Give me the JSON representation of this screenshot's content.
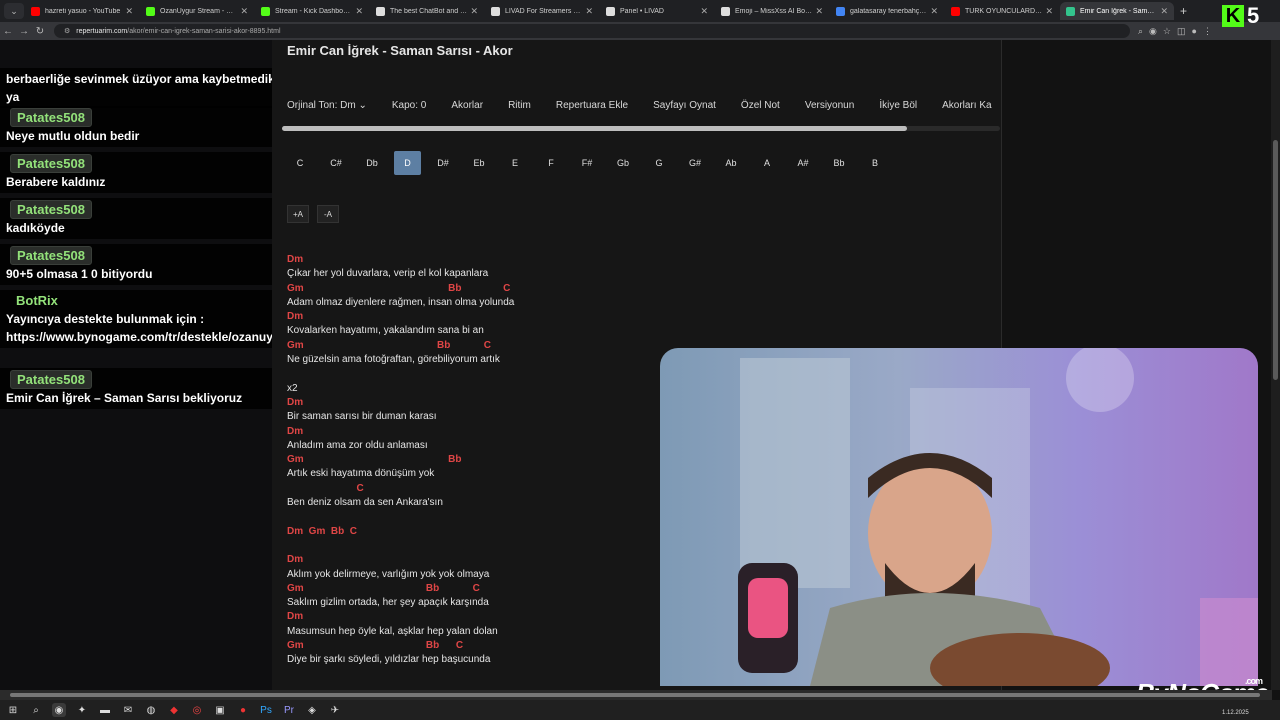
{
  "browser": {
    "tabs": [
      {
        "label": "hazreti yasuo - YouTube",
        "color": "#ff0000"
      },
      {
        "label": "OzanUygur Stream - Watch L",
        "color": "#53fc18"
      },
      {
        "label": "Stream - Kick Dashboard",
        "color": "#53fc18"
      },
      {
        "label": "The best ChatBot and Widget",
        "color": "#dddddd"
      },
      {
        "label": "LIVAD For Streamers - Monet",
        "color": "#dddddd"
      },
      {
        "label": "Panel • LIVAD",
        "color": "#dddddd"
      },
      {
        "label": "Emoji – MissXss AI Bot System",
        "color": "#dddddd"
      },
      {
        "label": "galatasaray fenerbahçe - Goo",
        "color": "#4285f4"
      },
      {
        "label": "TÜRK OYUNCULARDAN ŞİNİR",
        "color": "#ff0000"
      },
      {
        "label": "Emir Can İğrek - Saman Sarıs",
        "color": "#33c48d"
      }
    ],
    "url_host": "repertuarim.com",
    "url_path": "/akor/emir-can-igrek-saman-sarisi-akor-8895.html"
  },
  "kick": {
    "logo_letter": "K",
    "number": "5"
  },
  "chat": {
    "messages": [
      {
        "user": "",
        "text": "berbaerliğe sevinmek üzüyor ama kaybetmedik ya"
      },
      {
        "user": "Patates508",
        "text": "Neye mutlu oldun bedir"
      },
      {
        "user": "Patates508",
        "text": "Berabere kaldınız"
      },
      {
        "user": "Patates508",
        "text": "kadıköyde"
      },
      {
        "user": "Patates508",
        "text": "90+5 olmasa 1 0 bitiyordu"
      },
      {
        "user": "BotRix",
        "text": "Yayıncıya destekte bulunmak için : https://www.bynogame.com/tr/destekle/ozanuygur"
      },
      {
        "user": "Patates508",
        "text": "Emir Can İğrek – Saman Sarısı bekliyoruz"
      }
    ]
  },
  "song": {
    "title": "Emir Can İğrek - Saman Sarısı - Akor",
    "menu": [
      "Orjinal Ton: Dm",
      "Kapo: 0",
      "Akorlar",
      "Ritim",
      "Repertuara Ekle",
      "Sayfayı Oynat",
      "Özel Not",
      "Versiyonun",
      "İkiye Böl",
      "Akorları Ka"
    ],
    "keys": [
      "C",
      "C#",
      "Db",
      "D",
      "D#",
      "Eb",
      "E",
      "F",
      "F#",
      "Gb",
      "G",
      "G#",
      "Ab",
      "A",
      "A#",
      "Bb",
      "B"
    ],
    "selected_key": "D",
    "transpose_up": "+A",
    "transpose_down": "-A",
    "lines": [
      {
        "t": "ch",
        "v": "Dm"
      },
      {
        "t": "ly",
        "v": "Çıkar her yol duvarlara, verip el kol kapanlara"
      },
      {
        "t": "ch",
        "v": "Gm                                                    Bb               C"
      },
      {
        "t": "ly",
        "v": "Adam olmaz diyenlere rağmen, insan olma yolunda"
      },
      {
        "t": "ch",
        "v": "Dm"
      },
      {
        "t": "ly",
        "v": "Kovalarken hayatımı, yakalandım sana bi an"
      },
      {
        "t": "ch",
        "v": "Gm                                                Bb            C"
      },
      {
        "t": "ly",
        "v": "Ne güzelsin ama fotoğraftan, görebiliyorum artık"
      },
      {
        "t": "gap",
        "v": ""
      },
      {
        "t": "ly",
        "v": "x2"
      },
      {
        "t": "ch",
        "v": "Dm"
      },
      {
        "t": "ly",
        "v": "Bir saman sarısı bir duman karası"
      },
      {
        "t": "ch",
        "v": "Dm"
      },
      {
        "t": "ly",
        "v": "Anladım ama zor oldu anlaması"
      },
      {
        "t": "ch",
        "v": "Gm                                                    Bb"
      },
      {
        "t": "ly",
        "v": "Artık eski hayatıma dönüşüm yok"
      },
      {
        "t": "ch",
        "v": "                         C"
      },
      {
        "t": "ly",
        "v": "Ben deniz olsam da sen Ankara'sın"
      },
      {
        "t": "gap",
        "v": ""
      },
      {
        "t": "ch",
        "v": "Dm  Gm  Bb  C"
      },
      {
        "t": "gap",
        "v": ""
      },
      {
        "t": "ch",
        "v": "Dm"
      },
      {
        "t": "ly",
        "v": "Aklım yok delirmeye, varlığım yok yok olmaya"
      },
      {
        "t": "ch",
        "v": "Gm                                            Bb            C"
      },
      {
        "t": "ly",
        "v": "Saklım gizlim ortada, her şey apaçık karşında"
      },
      {
        "t": "ch",
        "v": "Dm"
      },
      {
        "t": "ly",
        "v": "Masumsun hep öyle kal, aşklar hep yalan dolan"
      },
      {
        "t": "ch",
        "v": "Gm                                            Bb      C"
      },
      {
        "t": "ly",
        "v": "Diye bir şarkı söyledi, yıldızlar hep başucunda"
      }
    ]
  },
  "overlay": {
    "brand": "ByNoGame",
    "brand_suffix": ".com"
  },
  "taskbar": {
    "date": "1.12.2025"
  }
}
